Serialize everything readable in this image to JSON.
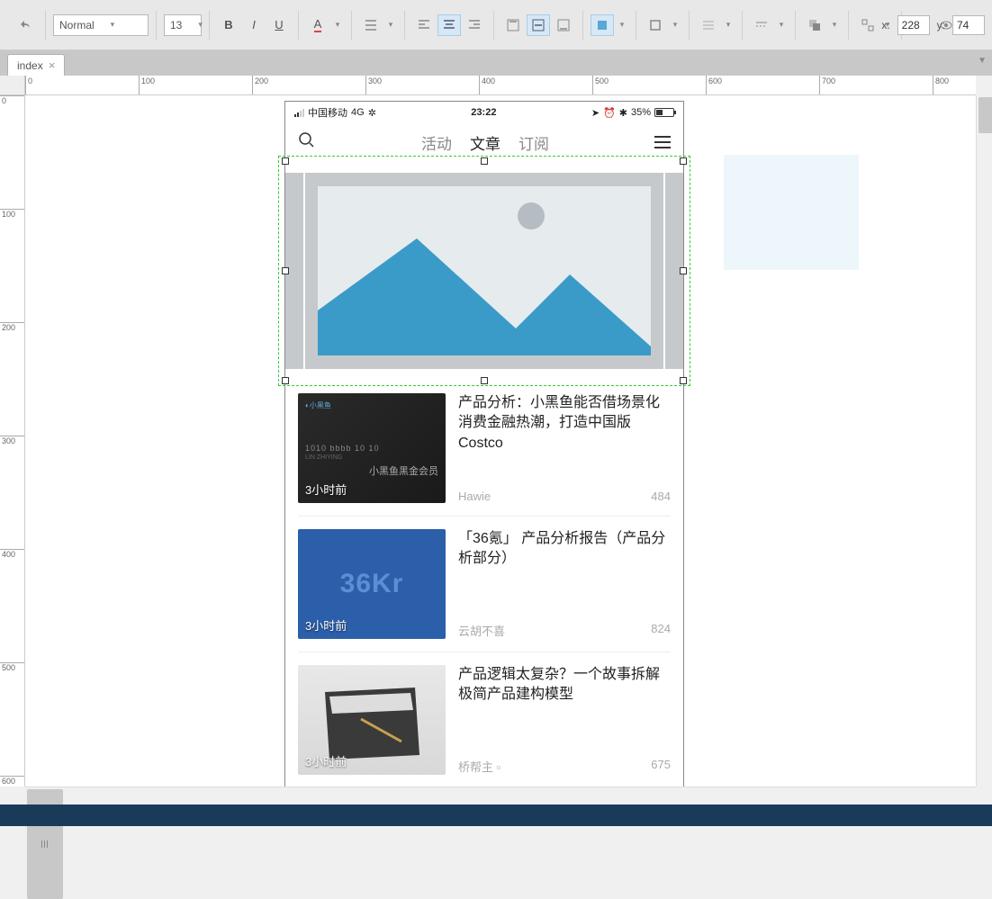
{
  "toolbar": {
    "style_dropdown": "Normal",
    "fontsize_dropdown": "13",
    "coord_x_label": "x:",
    "coord_x_value": "228",
    "coord_y_label": "y:",
    "coord_y_value": "74"
  },
  "tab": {
    "name": "index"
  },
  "ruler_h": [
    "0",
    "100",
    "200",
    "300",
    "400",
    "500",
    "600",
    "700",
    "800"
  ],
  "ruler_v": [
    "0",
    "100",
    "200",
    "300",
    "400",
    "500",
    "600"
  ],
  "phone": {
    "status": {
      "carrier": "中国移动",
      "network": "4G",
      "time": "23:22",
      "battery_pct": "35%"
    },
    "nav": {
      "tabs": [
        "活动",
        "文章",
        "订阅"
      ],
      "active_index": 1
    },
    "articles": [
      {
        "time": "3小时前",
        "title": "产品分析：小黑鱼能否借场景化消费金融热潮，打造中国版Costco",
        "author": "Hawie",
        "count": "484",
        "thumb_text1": "1010 bbbb 10 10",
        "thumb_text2": "小黑鱼黑金会员"
      },
      {
        "time": "3小时前",
        "title": "「36氪」 产品分析报告（产品分析部分）",
        "author": "云胡不喜",
        "count": "824",
        "thumb_logo": "36Kr"
      },
      {
        "time": "3小时前",
        "title": "产品逻辑太复杂？一个故事拆解极简产品建构模型",
        "author": "桥帮主",
        "count": "675"
      }
    ]
  }
}
